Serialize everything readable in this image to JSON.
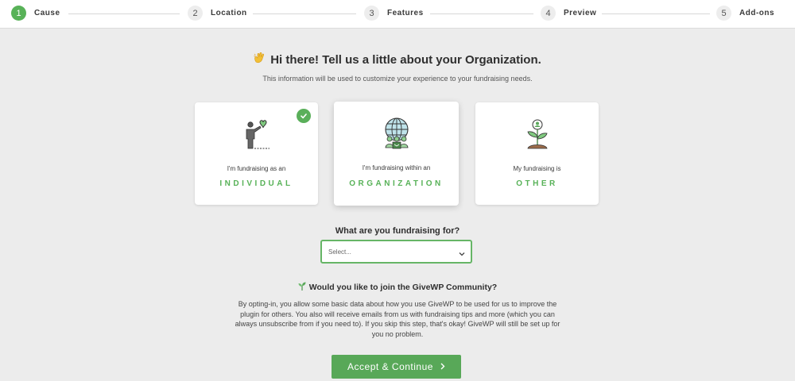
{
  "stepper": {
    "steps": [
      {
        "number": "1",
        "label": "Cause",
        "active": true
      },
      {
        "number": "2",
        "label": "Location",
        "active": false
      },
      {
        "number": "3",
        "label": "Features",
        "active": false
      },
      {
        "number": "4",
        "label": "Preview",
        "active": false
      },
      {
        "number": "5",
        "label": "Add-ons",
        "active": false
      }
    ]
  },
  "header": {
    "headline": "Hi there! Tell us a little about your Organization.",
    "headline_icon": "waving-hand-icon",
    "subtext": "This information will be used to customize your experience to your fundraising needs."
  },
  "cards": [
    {
      "caption": "I'm fundraising as an",
      "title": "INDIVIDUAL",
      "icon": "individual-person-heart-icon",
      "selected": true
    },
    {
      "caption": "I'm fundraising within an",
      "title": "ORGANIZATION",
      "icon": "globe-people-icon",
      "selected": false
    },
    {
      "caption": "My fundraising is",
      "title": "OTHER",
      "icon": "sprout-plant-icon",
      "selected": false
    }
  ],
  "fundraising_for": {
    "question": "What are you fundraising for?",
    "select_value": "Select..."
  },
  "community": {
    "heading": "Would you like to join the GiveWP Community?",
    "paragraph": "By opting-in, you allow some basic data about how you use GiveWP to be used for us to improve the plugin for others. You also will receive emails from us with fundraising tips and more (which you can always unsubscribe from if you need to). If you skip this step, that's okay! GiveWP will still be set up for you no problem."
  },
  "actions": {
    "accept_label": "Accept & Continue"
  },
  "colors": {
    "accent": "#58b258",
    "background": "#ececec",
    "card": "#ffffff"
  }
}
